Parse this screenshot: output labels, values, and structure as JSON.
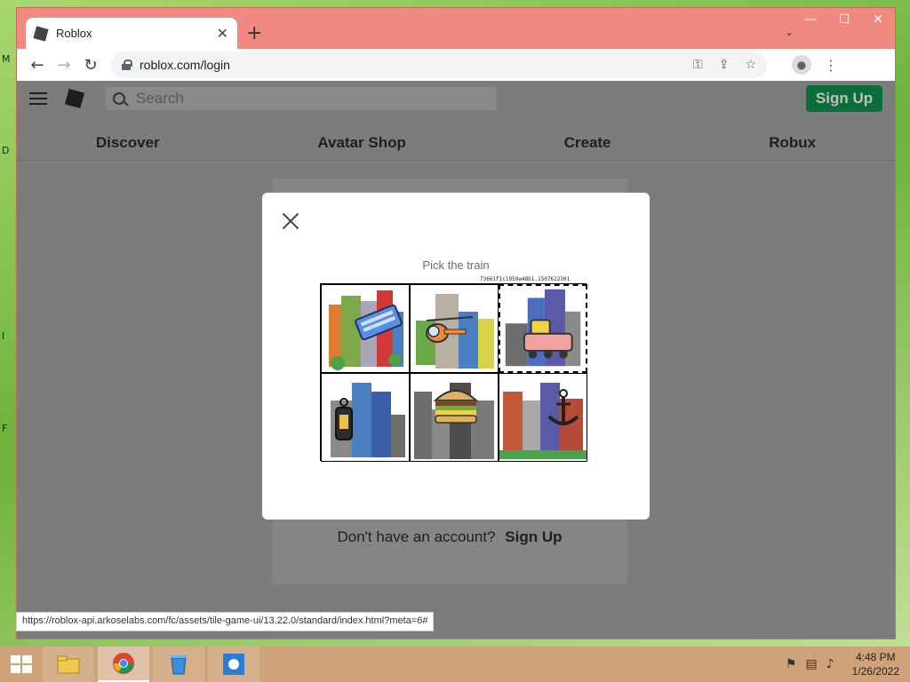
{
  "desktop": {
    "edge_letters": [
      "M",
      "D",
      "I",
      "F"
    ]
  },
  "window": {
    "controls": {
      "minimize": "—",
      "maximize": "☐",
      "close": "✕"
    },
    "tab": {
      "title": "Roblox",
      "close_glyph": "✕"
    },
    "newtab_glyph": "+",
    "tab_search_glyph": "⌄"
  },
  "toolbar": {
    "back_glyph": "←",
    "forward_glyph": "→",
    "reload_glyph": "↻",
    "url": "roblox.com/login",
    "icons": [
      "key-icon",
      "share-icon",
      "star-icon",
      "profile-icon",
      "menu-icon"
    ]
  },
  "roblox": {
    "search_placeholder": "Search",
    "signup_label": "Sign Up",
    "nav": [
      "Discover",
      "Avatar Shop",
      "Create",
      "Robux"
    ],
    "no_account_text": "Don't have an account?",
    "no_account_link": "Sign Up"
  },
  "captcha": {
    "instruction": "Pick the train",
    "token": "73661f1c1959a48b1.1507622301",
    "tiles": [
      {
        "name": "tile-keyboard",
        "depicts": "keyboard",
        "selected": false
      },
      {
        "name": "tile-helicopter",
        "depicts": "helicopter",
        "selected": false
      },
      {
        "name": "tile-train",
        "depicts": "train",
        "selected": true
      },
      {
        "name": "tile-lantern",
        "depicts": "lantern",
        "selected": false
      },
      {
        "name": "tile-burger",
        "depicts": "burger",
        "selected": false
      },
      {
        "name": "tile-anchor",
        "depicts": "anchor",
        "selected": false
      }
    ]
  },
  "status_bar": {
    "text": "https://roblox-api.arkoselabs.com/fc/assets/tile-game-ui/13.22.0/standard/index.html?meta=6#"
  },
  "taskbar": {
    "apps": [
      "file-explorer",
      "chrome",
      "recycle-bin",
      "weather"
    ],
    "clock": {
      "time": "4:48 PM",
      "date": "1/26/2022"
    }
  }
}
